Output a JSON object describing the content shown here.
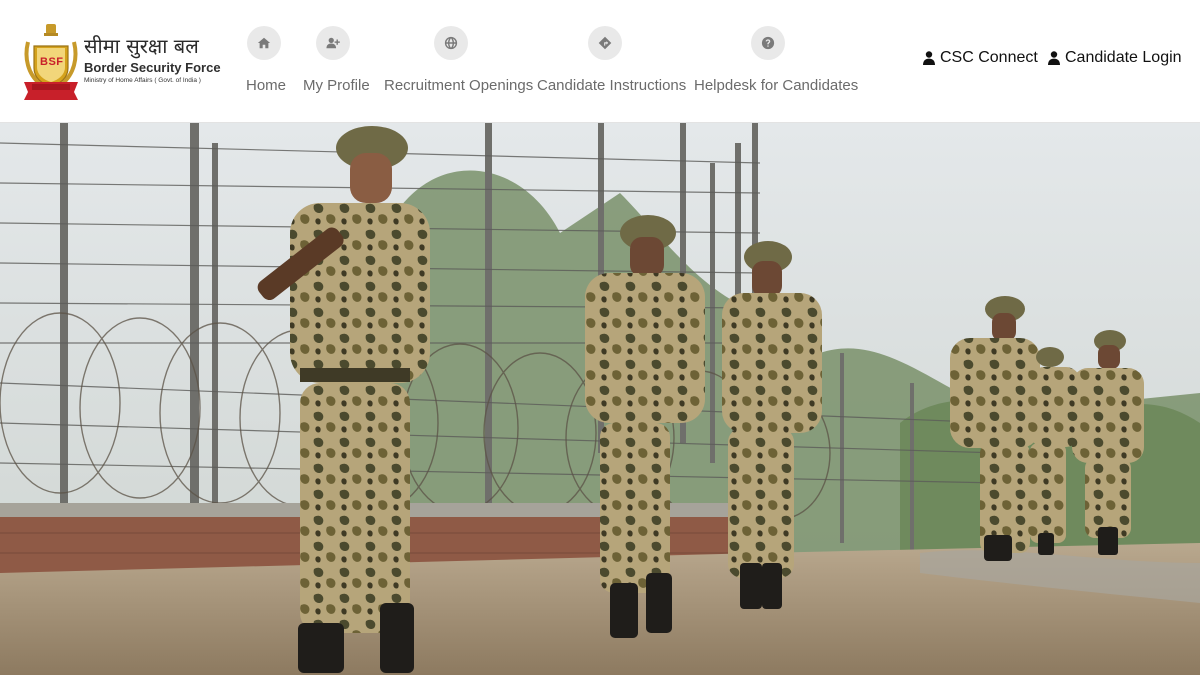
{
  "logo": {
    "badge_text": "BSF",
    "hindi_name": "सीमा सुरक्षा बल",
    "english_name": "Border Security Force",
    "ministry": "Ministry of Home Affairs ( Govt. of India )"
  },
  "nav": {
    "items": [
      {
        "label": "Home",
        "icon": "home-icon"
      },
      {
        "label": "My Profile",
        "icon": "user-plus-icon"
      },
      {
        "label": "Recruitment Openings",
        "icon": "globe-icon"
      },
      {
        "label": "Candidate Instructions",
        "icon": "directions-icon"
      },
      {
        "label": "Helpdesk for Candidates",
        "icon": "question-icon"
      }
    ]
  },
  "right_links": {
    "csc_connect": "CSC Connect",
    "candidate_login": "Candidate Login"
  },
  "hero": {
    "image": "Border Security Force personnel patrolling along barbed wire fence"
  },
  "colors": {
    "nav_text": "#6b6b6b",
    "icon_bg": "#e9e9e9",
    "badge_red": "#c8202a",
    "badge_gold": "#d4a21c"
  }
}
